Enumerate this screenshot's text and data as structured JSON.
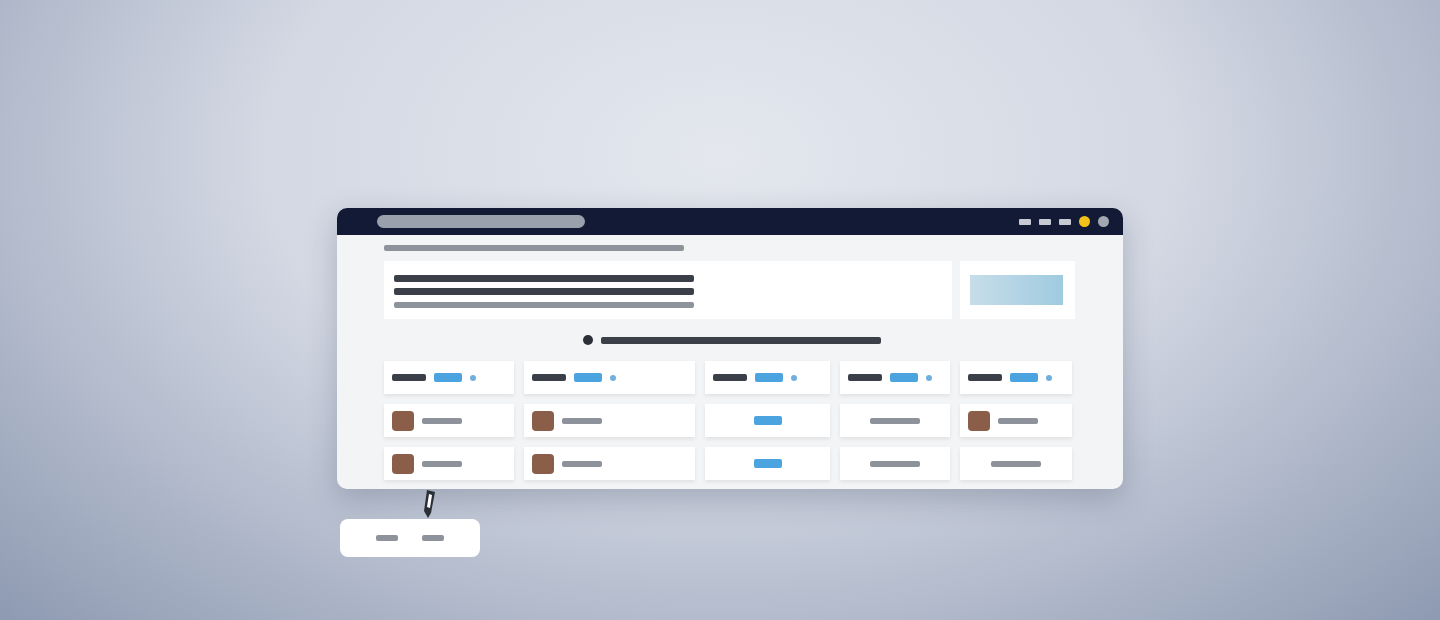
{
  "toolbar": {
    "indicators": [
      {
        "kind": "glyph"
      },
      {
        "kind": "glyph"
      },
      {
        "kind": "glyph"
      },
      {
        "kind": "dot",
        "color": "#f2c21b"
      },
      {
        "kind": "dot",
        "color": "#a3a8b0"
      }
    ]
  },
  "hero": {
    "kind": "text-block"
  },
  "side_card": {
    "kind": "image"
  },
  "headline": {
    "kind": "icon-heading"
  },
  "grid": {
    "rows": [
      [
        {
          "kind": "tags"
        },
        {
          "kind": "tags"
        },
        {
          "kind": "tags"
        },
        {
          "kind": "tags"
        },
        {
          "kind": "tags"
        }
      ],
      [
        {
          "kind": "avatar"
        },
        {
          "kind": "avatar"
        },
        {
          "kind": "chip"
        },
        {
          "kind": "text"
        },
        {
          "kind": "avatar"
        }
      ],
      [
        {
          "kind": "avatar"
        },
        {
          "kind": "avatar"
        },
        {
          "kind": "chip"
        },
        {
          "kind": "text"
        },
        {
          "kind": "text"
        }
      ]
    ]
  },
  "tooltip": {
    "kind": "pointer"
  }
}
